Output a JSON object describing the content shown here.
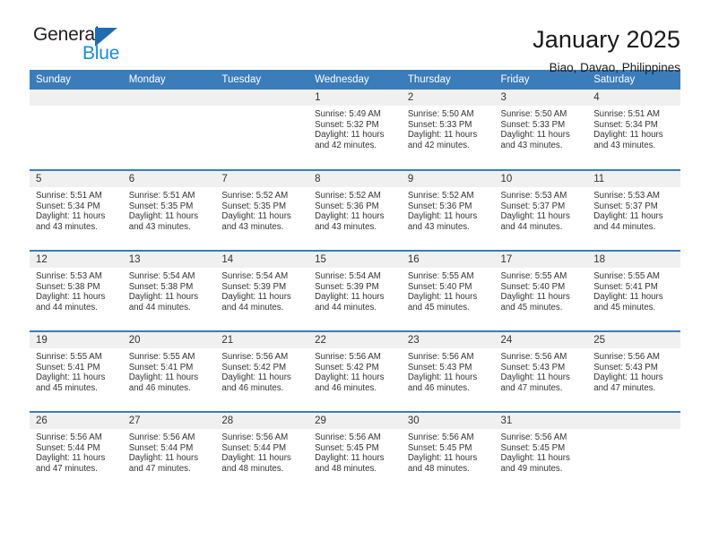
{
  "brand": {
    "name_part1": "General",
    "name_part2": "Blue",
    "flag_color": "#1f6cb0",
    "blue_text_color": "#1a8bd4"
  },
  "header": {
    "title": "January 2025",
    "subtitle": "Biao, Davao, Philippines"
  },
  "theme": {
    "header_bg": "#3b7cba",
    "header_text": "#ffffff",
    "daynum_bg": "#f0f0f0",
    "body_text": "#333333"
  },
  "weekday_headers": [
    "Sunday",
    "Monday",
    "Tuesday",
    "Wednesday",
    "Thursday",
    "Friday",
    "Saturday"
  ],
  "labels": {
    "sunrise": "Sunrise:",
    "sunset": "Sunset:",
    "daylight": "Daylight:"
  },
  "weeks": [
    [
      {
        "day": "",
        "empty": true
      },
      {
        "day": "",
        "empty": true
      },
      {
        "day": "",
        "empty": true
      },
      {
        "day": "1",
        "sunrise": "Sunrise: 5:49 AM",
        "sunset": "Sunset: 5:32 PM",
        "daylight_line1": "Daylight: 11 hours",
        "daylight_line2": "and 42 minutes."
      },
      {
        "day": "2",
        "sunrise": "Sunrise: 5:50 AM",
        "sunset": "Sunset: 5:33 PM",
        "daylight_line1": "Daylight: 11 hours",
        "daylight_line2": "and 42 minutes."
      },
      {
        "day": "3",
        "sunrise": "Sunrise: 5:50 AM",
        "sunset": "Sunset: 5:33 PM",
        "daylight_line1": "Daylight: 11 hours",
        "daylight_line2": "and 43 minutes."
      },
      {
        "day": "4",
        "sunrise": "Sunrise: 5:51 AM",
        "sunset": "Sunset: 5:34 PM",
        "daylight_line1": "Daylight: 11 hours",
        "daylight_line2": "and 43 minutes."
      }
    ],
    [
      {
        "day": "5",
        "sunrise": "Sunrise: 5:51 AM",
        "sunset": "Sunset: 5:34 PM",
        "daylight_line1": "Daylight: 11 hours",
        "daylight_line2": "and 43 minutes."
      },
      {
        "day": "6",
        "sunrise": "Sunrise: 5:51 AM",
        "sunset": "Sunset: 5:35 PM",
        "daylight_line1": "Daylight: 11 hours",
        "daylight_line2": "and 43 minutes."
      },
      {
        "day": "7",
        "sunrise": "Sunrise: 5:52 AM",
        "sunset": "Sunset: 5:35 PM",
        "daylight_line1": "Daylight: 11 hours",
        "daylight_line2": "and 43 minutes."
      },
      {
        "day": "8",
        "sunrise": "Sunrise: 5:52 AM",
        "sunset": "Sunset: 5:36 PM",
        "daylight_line1": "Daylight: 11 hours",
        "daylight_line2": "and 43 minutes."
      },
      {
        "day": "9",
        "sunrise": "Sunrise: 5:52 AM",
        "sunset": "Sunset: 5:36 PM",
        "daylight_line1": "Daylight: 11 hours",
        "daylight_line2": "and 43 minutes."
      },
      {
        "day": "10",
        "sunrise": "Sunrise: 5:53 AM",
        "sunset": "Sunset: 5:37 PM",
        "daylight_line1": "Daylight: 11 hours",
        "daylight_line2": "and 44 minutes."
      },
      {
        "day": "11",
        "sunrise": "Sunrise: 5:53 AM",
        "sunset": "Sunset: 5:37 PM",
        "daylight_line1": "Daylight: 11 hours",
        "daylight_line2": "and 44 minutes."
      }
    ],
    [
      {
        "day": "12",
        "sunrise": "Sunrise: 5:53 AM",
        "sunset": "Sunset: 5:38 PM",
        "daylight_line1": "Daylight: 11 hours",
        "daylight_line2": "and 44 minutes."
      },
      {
        "day": "13",
        "sunrise": "Sunrise: 5:54 AM",
        "sunset": "Sunset: 5:38 PM",
        "daylight_line1": "Daylight: 11 hours",
        "daylight_line2": "and 44 minutes."
      },
      {
        "day": "14",
        "sunrise": "Sunrise: 5:54 AM",
        "sunset": "Sunset: 5:39 PM",
        "daylight_line1": "Daylight: 11 hours",
        "daylight_line2": "and 44 minutes."
      },
      {
        "day": "15",
        "sunrise": "Sunrise: 5:54 AM",
        "sunset": "Sunset: 5:39 PM",
        "daylight_line1": "Daylight: 11 hours",
        "daylight_line2": "and 44 minutes."
      },
      {
        "day": "16",
        "sunrise": "Sunrise: 5:55 AM",
        "sunset": "Sunset: 5:40 PM",
        "daylight_line1": "Daylight: 11 hours",
        "daylight_line2": "and 45 minutes."
      },
      {
        "day": "17",
        "sunrise": "Sunrise: 5:55 AM",
        "sunset": "Sunset: 5:40 PM",
        "daylight_line1": "Daylight: 11 hours",
        "daylight_line2": "and 45 minutes."
      },
      {
        "day": "18",
        "sunrise": "Sunrise: 5:55 AM",
        "sunset": "Sunset: 5:41 PM",
        "daylight_line1": "Daylight: 11 hours",
        "daylight_line2": "and 45 minutes."
      }
    ],
    [
      {
        "day": "19",
        "sunrise": "Sunrise: 5:55 AM",
        "sunset": "Sunset: 5:41 PM",
        "daylight_line1": "Daylight: 11 hours",
        "daylight_line2": "and 45 minutes."
      },
      {
        "day": "20",
        "sunrise": "Sunrise: 5:55 AM",
        "sunset": "Sunset: 5:41 PM",
        "daylight_line1": "Daylight: 11 hours",
        "daylight_line2": "and 46 minutes."
      },
      {
        "day": "21",
        "sunrise": "Sunrise: 5:56 AM",
        "sunset": "Sunset: 5:42 PM",
        "daylight_line1": "Daylight: 11 hours",
        "daylight_line2": "and 46 minutes."
      },
      {
        "day": "22",
        "sunrise": "Sunrise: 5:56 AM",
        "sunset": "Sunset: 5:42 PM",
        "daylight_line1": "Daylight: 11 hours",
        "daylight_line2": "and 46 minutes."
      },
      {
        "day": "23",
        "sunrise": "Sunrise: 5:56 AM",
        "sunset": "Sunset: 5:43 PM",
        "daylight_line1": "Daylight: 11 hours",
        "daylight_line2": "and 46 minutes."
      },
      {
        "day": "24",
        "sunrise": "Sunrise: 5:56 AM",
        "sunset": "Sunset: 5:43 PM",
        "daylight_line1": "Daylight: 11 hours",
        "daylight_line2": "and 47 minutes."
      },
      {
        "day": "25",
        "sunrise": "Sunrise: 5:56 AM",
        "sunset": "Sunset: 5:43 PM",
        "daylight_line1": "Daylight: 11 hours",
        "daylight_line2": "and 47 minutes."
      }
    ],
    [
      {
        "day": "26",
        "sunrise": "Sunrise: 5:56 AM",
        "sunset": "Sunset: 5:44 PM",
        "daylight_line1": "Daylight: 11 hours",
        "daylight_line2": "and 47 minutes."
      },
      {
        "day": "27",
        "sunrise": "Sunrise: 5:56 AM",
        "sunset": "Sunset: 5:44 PM",
        "daylight_line1": "Daylight: 11 hours",
        "daylight_line2": "and 47 minutes."
      },
      {
        "day": "28",
        "sunrise": "Sunrise: 5:56 AM",
        "sunset": "Sunset: 5:44 PM",
        "daylight_line1": "Daylight: 11 hours",
        "daylight_line2": "and 48 minutes."
      },
      {
        "day": "29",
        "sunrise": "Sunrise: 5:56 AM",
        "sunset": "Sunset: 5:45 PM",
        "daylight_line1": "Daylight: 11 hours",
        "daylight_line2": "and 48 minutes."
      },
      {
        "day": "30",
        "sunrise": "Sunrise: 5:56 AM",
        "sunset": "Sunset: 5:45 PM",
        "daylight_line1": "Daylight: 11 hours",
        "daylight_line2": "and 48 minutes."
      },
      {
        "day": "31",
        "sunrise": "Sunrise: 5:56 AM",
        "sunset": "Sunset: 5:45 PM",
        "daylight_line1": "Daylight: 11 hours",
        "daylight_line2": "and 49 minutes."
      },
      {
        "day": "",
        "empty": true
      }
    ]
  ]
}
